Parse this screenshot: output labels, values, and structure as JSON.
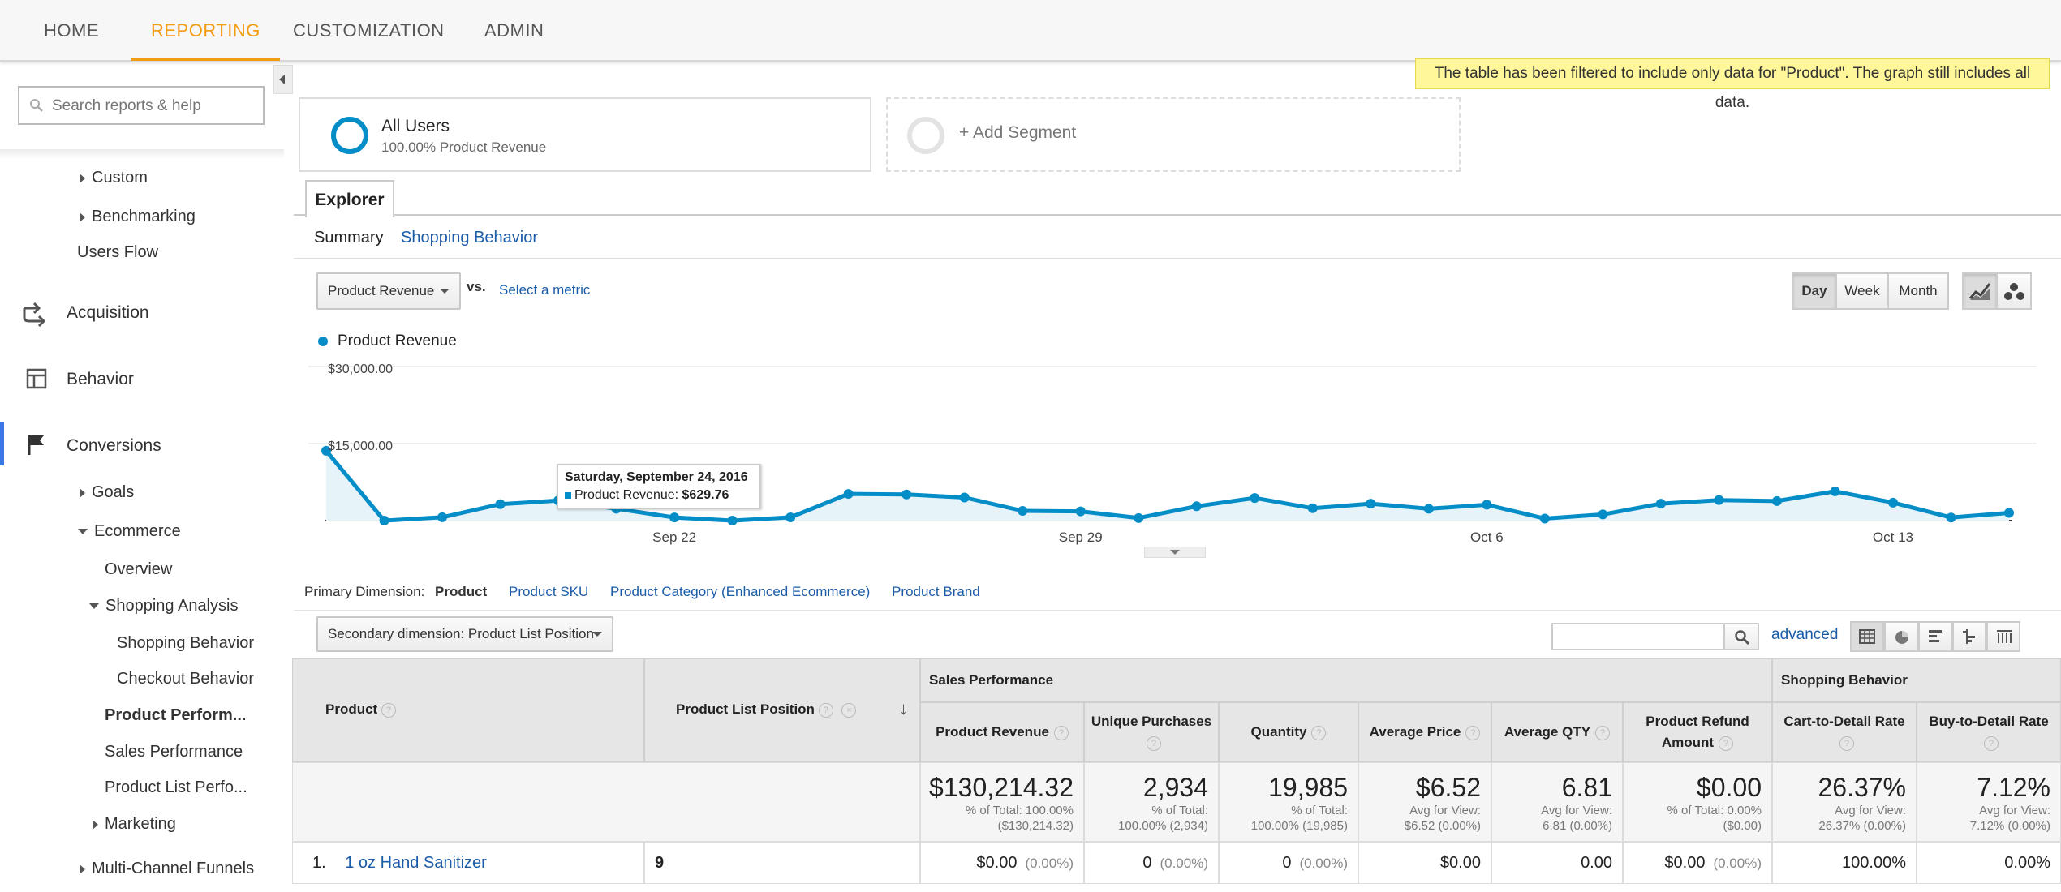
{
  "nav": {
    "tabs": [
      {
        "label": "HOME"
      },
      {
        "label": "REPORTING"
      },
      {
        "label": "CUSTOMIZATION"
      },
      {
        "label": "ADMIN"
      }
    ]
  },
  "sidebar": {
    "search_placeholder": "Search reports & help",
    "custom": "Custom",
    "benchmarking": "Benchmarking",
    "users_flow": "Users Flow",
    "acquisition": "Acquisition",
    "behavior": "Behavior",
    "conversions": "Conversions",
    "goals": "Goals",
    "ecommerce": "Ecommerce",
    "overview": "Overview",
    "shopping_analysis": "Shopping Analysis",
    "shopping_behavior": "Shopping Behavior",
    "checkout_behavior": "Checkout Behavior",
    "product_performance": "Product Perform...",
    "sales_performance": "Sales Performance",
    "product_list_performance": "Product List Perfo...",
    "marketing": "Marketing",
    "multi_channel": "Multi-Channel Funnels"
  },
  "filter_notice": "The table has been filtered to include only data for \"Product\". The graph still includes all data.",
  "segments": {
    "all_users_title": "All Users",
    "all_users_sub": "100.00% Product Revenue",
    "add_segment": "+ Add Segment"
  },
  "explorer": {
    "tab": "Explorer",
    "summary": "Summary",
    "shopping_behavior": "Shopping Behavior",
    "metric_dropdown": "Product Revenue",
    "vs": "vs.",
    "select_metric": "Select a metric",
    "day": "Day",
    "week": "Week",
    "month": "Month"
  },
  "chart_data": {
    "type": "line",
    "series": [
      {
        "name": "Product Revenue",
        "values": [
          13600,
          0,
          650,
          3200,
          3900,
          2300,
          620,
          0,
          630,
          5200,
          5100,
          4500,
          1900,
          1800,
          500,
          2800,
          4400,
          2400,
          3300,
          2300,
          3100,
          400,
          1200,
          3300,
          4000,
          3800,
          5700,
          3500,
          600,
          1500
        ]
      }
    ],
    "x_tick_labels": [
      "Sep 22",
      "Sep 29",
      "Oct 6",
      "Oct 13"
    ],
    "y_tick_labels": [
      "$30,000.00",
      "$15,000.00"
    ],
    "ylim": [
      0,
      30000
    ],
    "legend": "top-left",
    "color": "#058dc7"
  },
  "tooltip": {
    "date": "Saturday, September 24, 2016",
    "label": "Product Revenue:",
    "value": "$629.76"
  },
  "dimensions": {
    "label": "Primary Dimension:",
    "active": "Product",
    "links": [
      "Product SKU",
      "Product Category (Enhanced Ecommerce)",
      "Product Brand"
    ],
    "secondary": "Secondary dimension: Product List Position",
    "advanced": "advanced"
  },
  "table": {
    "col_product": "Product",
    "col_position": "Product List Position",
    "group_sales": "Sales Performance",
    "group_shopping": "Shopping Behavior",
    "metrics": [
      {
        "header": "Product Revenue",
        "total": "$130,214.32",
        "sub1": "% of Total: 100.00%",
        "sub2": "($130,214.32)",
        "row_value": "$0.00",
        "row_pct": "(0.00%)"
      },
      {
        "header": "Unique Purchases",
        "total": "2,934",
        "sub1": "% of Total:",
        "sub2": "100.00% (2,934)",
        "row_value": "0",
        "row_pct": "(0.00%)"
      },
      {
        "header": "Quantity",
        "total": "19,985",
        "sub1": "% of Total:",
        "sub2": "100.00% (19,985)",
        "row_value": "0",
        "row_pct": "(0.00%)"
      },
      {
        "header": "Average Price",
        "total": "$6.52",
        "sub1": "Avg for View:",
        "sub2": "$6.52 (0.00%)",
        "row_value": "$0.00",
        "row_pct": ""
      },
      {
        "header": "Average QTY",
        "total": "6.81",
        "sub1": "Avg for View:",
        "sub2": "6.81 (0.00%)",
        "row_value": "0.00",
        "row_pct": ""
      },
      {
        "header": "Product Refund Amount",
        "total": "$0.00",
        "sub1": "% of Total: 0.00%",
        "sub2": "($0.00)",
        "row_value": "$0.00",
        "row_pct": "(0.00%)"
      },
      {
        "header": "Cart-to-Detail Rate",
        "total": "26.37%",
        "sub1": "Avg for View:",
        "sub2": "26.37% (0.00%)",
        "row_value": "100.00%",
        "row_pct": ""
      },
      {
        "header": "Buy-to-Detail Rate",
        "total": "7.12%",
        "sub1": "Avg for View:",
        "sub2": "7.12% (0.00%)",
        "row_value": "0.00%",
        "row_pct": ""
      }
    ],
    "rows": [
      {
        "index": "1.",
        "product": "1 oz Hand Sanitizer",
        "position": "9"
      }
    ]
  }
}
